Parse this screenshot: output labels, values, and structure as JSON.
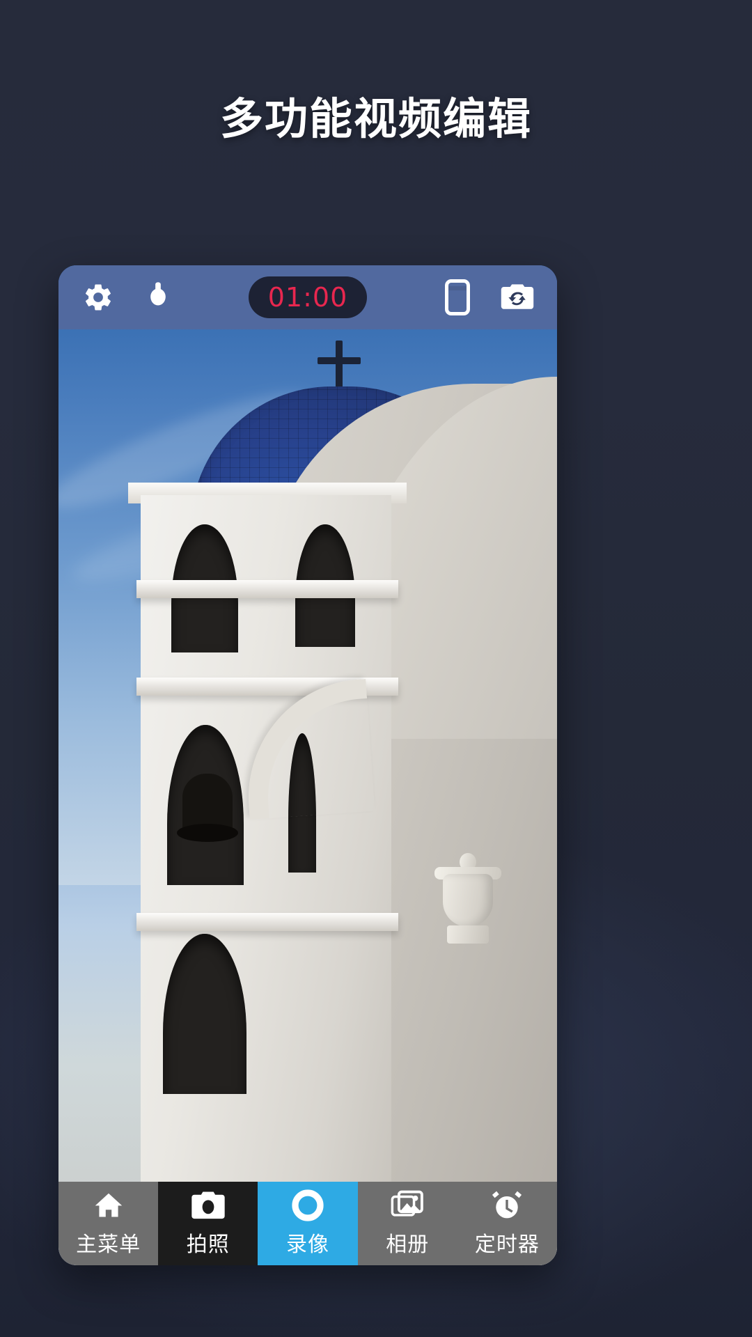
{
  "promo": {
    "headline": "多功能视频编辑",
    "background_top": "#262b3b",
    "background_bottom": "#1e2333"
  },
  "phone": {
    "toolbar": {
      "background": "#51699f",
      "settings_icon": "gear-icon",
      "flash_icon": "flash-bulb-icon",
      "ratio_icon": "screen-ratio-icon",
      "switch_camera_icon": "camera-switch-icon",
      "timer": {
        "value": "01:00",
        "text_color": "#e8274f",
        "pill_color": "#1d2234"
      }
    },
    "viewfinder": {
      "scene": "church-bell-tower-with-blue-tiled-dome",
      "sky_color": "#4a7dbd",
      "dome_color": "#27408a",
      "wall_color": "#d8d5ce"
    },
    "bottom_nav": {
      "active_color": "#2eaae4",
      "inactive_color": "#6e6e6e",
      "dark_color": "#1c1c1c",
      "items": [
        {
          "label": "主菜单",
          "icon": "home-icon",
          "state": "inactive"
        },
        {
          "label": "拍照",
          "icon": "camera-icon",
          "state": "dark"
        },
        {
          "label": "录像",
          "icon": "record-icon",
          "state": "active"
        },
        {
          "label": "相册",
          "icon": "gallery-icon",
          "state": "inactive"
        },
        {
          "label": "定时器",
          "icon": "alarm-clock-icon",
          "state": "inactive"
        }
      ]
    }
  }
}
